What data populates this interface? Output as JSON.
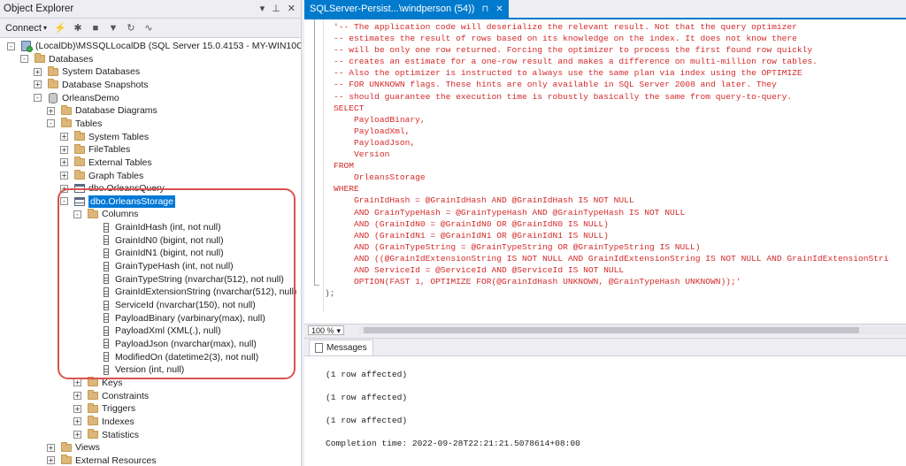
{
  "object_explorer": {
    "title": "Object Explorer",
    "toolbar": {
      "connect_label": "Connect"
    },
    "tree": [
      {
        "depth": 0,
        "exp": "-",
        "icon": "server",
        "label": "(LocalDb)\\MSSQLLocalDB (SQL Server 15.0.4153 - MY-WIN10CH'",
        "name": "server-node"
      },
      {
        "depth": 1,
        "exp": "-",
        "icon": "folder",
        "label": "Databases",
        "name": "databases-folder"
      },
      {
        "depth": 2,
        "exp": "+",
        "icon": "folder",
        "label": "System Databases",
        "name": "system-databases-folder"
      },
      {
        "depth": 2,
        "exp": "+",
        "icon": "folder",
        "label": "Database Snapshots",
        "name": "database-snapshots-folder"
      },
      {
        "depth": 2,
        "exp": "-",
        "icon": "db",
        "label": "OrleansDemo",
        "name": "orleansdemo-database"
      },
      {
        "depth": 3,
        "exp": "+",
        "icon": "folder",
        "label": "Database Diagrams",
        "name": "database-diagrams-folder"
      },
      {
        "depth": 3,
        "exp": "-",
        "icon": "folder",
        "label": "Tables",
        "name": "tables-folder"
      },
      {
        "depth": 4,
        "exp": "+",
        "icon": "folder",
        "label": "System Tables",
        "name": "system-tables-folder"
      },
      {
        "depth": 4,
        "exp": "+",
        "icon": "folder",
        "label": "FileTables",
        "name": "filetables-folder"
      },
      {
        "depth": 4,
        "exp": "+",
        "icon": "folder",
        "label": "External Tables",
        "name": "external-tables-folder"
      },
      {
        "depth": 4,
        "exp": "+",
        "icon": "folder",
        "label": "Graph Tables",
        "name": "graph-tables-folder"
      },
      {
        "depth": 4,
        "exp": "+",
        "icon": "table",
        "label": "dbo.OrleansQuery",
        "name": "orleansquery-table"
      },
      {
        "depth": 4,
        "exp": "-",
        "icon": "table",
        "label": "dbo.OrleansStorage",
        "name": "orleansstorage-table",
        "selected": true
      },
      {
        "depth": 5,
        "exp": "-",
        "icon": "folder",
        "label": "Columns",
        "name": "columns-folder"
      },
      {
        "depth": 6,
        "exp": "",
        "icon": "col",
        "label": "GrainIdHash (int, not null)",
        "name": "column-item"
      },
      {
        "depth": 6,
        "exp": "",
        "icon": "col",
        "label": "GrainIdN0 (bigint, not null)",
        "name": "column-item"
      },
      {
        "depth": 6,
        "exp": "",
        "icon": "col",
        "label": "GrainIdN1 (bigint, not null)",
        "name": "column-item"
      },
      {
        "depth": 6,
        "exp": "",
        "icon": "col",
        "label": "GrainTypeHash (int, not null)",
        "name": "column-item"
      },
      {
        "depth": 6,
        "exp": "",
        "icon": "col",
        "label": "GrainTypeString (nvarchar(512), not null)",
        "name": "column-item"
      },
      {
        "depth": 6,
        "exp": "",
        "icon": "col",
        "label": "GrainIdExtensionString (nvarchar(512), null)",
        "name": "column-item"
      },
      {
        "depth": 6,
        "exp": "",
        "icon": "col",
        "label": "ServiceId (nvarchar(150), not null)",
        "name": "column-item"
      },
      {
        "depth": 6,
        "exp": "",
        "icon": "col",
        "label": "PayloadBinary (varbinary(max), null)",
        "name": "column-item"
      },
      {
        "depth": 6,
        "exp": "",
        "icon": "col",
        "label": "PayloadXml (XML(.), null)",
        "name": "column-item"
      },
      {
        "depth": 6,
        "exp": "",
        "icon": "col",
        "label": "PayloadJson (nvarchar(max), null)",
        "name": "column-item"
      },
      {
        "depth": 6,
        "exp": "",
        "icon": "col",
        "label": "ModifiedOn (datetime2(3), not null)",
        "name": "column-item"
      },
      {
        "depth": 6,
        "exp": "",
        "icon": "col",
        "label": "Version (int, null)",
        "name": "column-item"
      },
      {
        "depth": 5,
        "exp": "+",
        "icon": "folder",
        "label": "Keys",
        "name": "keys-folder"
      },
      {
        "depth": 5,
        "exp": "+",
        "icon": "folder",
        "label": "Constraints",
        "name": "constraints-folder"
      },
      {
        "depth": 5,
        "exp": "+",
        "icon": "folder",
        "label": "Triggers",
        "name": "triggers-folder"
      },
      {
        "depth": 5,
        "exp": "+",
        "icon": "folder",
        "label": "Indexes",
        "name": "indexes-folder"
      },
      {
        "depth": 5,
        "exp": "+",
        "icon": "folder",
        "label": "Statistics",
        "name": "statistics-folder"
      },
      {
        "depth": 3,
        "exp": "+",
        "icon": "folder",
        "label": "Views",
        "name": "views-folder"
      },
      {
        "depth": 3,
        "exp": "+",
        "icon": "folder",
        "label": "External Resources",
        "name": "external-resources-folder"
      }
    ]
  },
  "editor": {
    "tab_title": "SQLServer-Persist...\\windperson (54))",
    "code_lines": [
      "'-- The application code will deserialize the relevant result. Not that the query optimizer",
      "-- estimates the result of rows based on its knowledge on the index. It does not know there",
      "-- will be only one row returned. Forcing the optimizer to process the first found row quickly",
      "-- creates an estimate for a one-row result and makes a difference on multi-million row tables.",
      "-- Also the optimizer is instructed to always use the same plan via index using the OPTIMIZE",
      "-- FOR UNKNOWN flags. These hints are only available in SQL Server 2008 and later. They",
      "-- should guarantee the execution time is robustly basically the same from query-to-query.",
      "SELECT",
      "    PayloadBinary,",
      "    PayloadXml,",
      "    PayloadJson,",
      "    Version",
      "FROM",
      "    OrleansStorage",
      "WHERE",
      "    GrainIdHash = @GrainIdHash AND @GrainIdHash IS NOT NULL",
      "    AND GrainTypeHash = @GrainTypeHash AND @GrainTypeHash IS NOT NULL",
      "    AND (GrainIdN0 = @GrainIdN0 OR @GrainIdN0 IS NULL)",
      "    AND (GrainIdN1 = @GrainIdN1 OR @GrainIdN1 IS NULL)",
      "    AND (GrainTypeString = @GrainTypeString OR @GrainTypeString IS NULL)",
      "    AND ((@GrainIdExtensionString IS NOT NULL AND GrainIdExtensionString IS NOT NULL AND GrainIdExtensionStri",
      "    AND ServiceId = @ServiceId AND @ServiceId IS NOT NULL",
      "    OPTION(FAST 1, OPTIMIZE FOR(@GrainIdHash UNKNOWN, @GrainTypeHash UNKNOWN));'"
    ],
    "closing_line": ");",
    "zoom_level": "100 %"
  },
  "results": {
    "tab_label": "Messages",
    "messages": [
      "(1 row affected)",
      "(1 row affected)",
      "(1 row affected)",
      "Completion time: 2022-09-28T22:21:21.5078614+08:00"
    ]
  },
  "colors": {
    "accent": "#007acc",
    "selection": "#0078d7",
    "code_text": "#d42a2a",
    "highlight_ring": "#d9534f"
  }
}
